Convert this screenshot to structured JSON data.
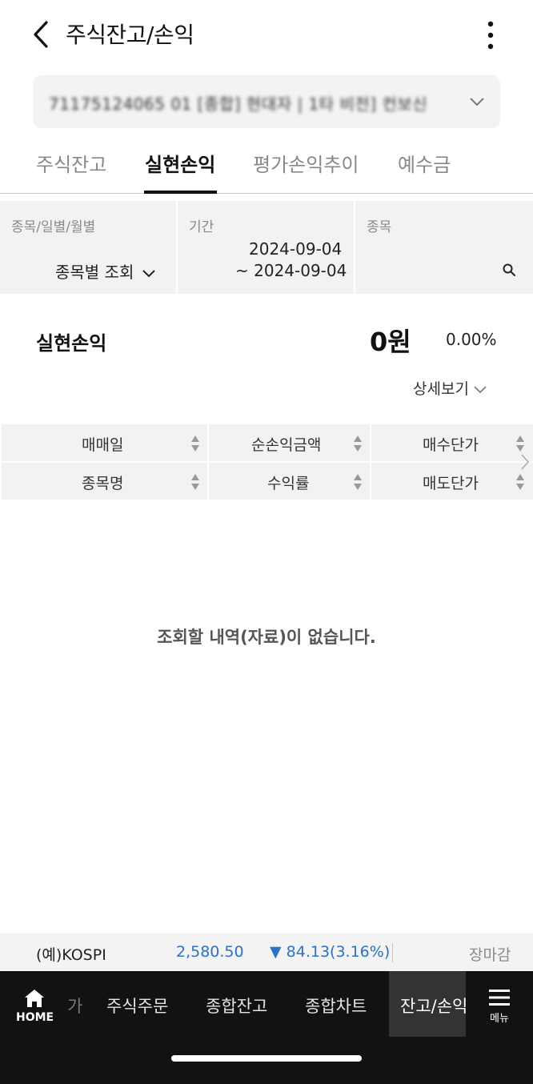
{
  "header": {
    "title": "주식잔고/손익",
    "back_icon": "chevron-left-icon",
    "more_icon": "more-vertical-icon"
  },
  "account": {
    "text": "71175124065 01 [종합] 현대자 | 1타 비전] 컨보신"
  },
  "tabs": [
    {
      "label": "주식잔고",
      "active": false
    },
    {
      "label": "실현손익",
      "active": true
    },
    {
      "label": "평가손익추이",
      "active": false
    },
    {
      "label": "예수금",
      "active": false
    }
  ],
  "filters": {
    "mode": {
      "label": "종목/일별/월별",
      "value": "종목별 조회"
    },
    "period": {
      "label": "기간",
      "from": "2024-09-04",
      "to": "~ 2024-09-04"
    },
    "stock": {
      "label": "종목",
      "value": ""
    }
  },
  "summary": {
    "label": "실현손익",
    "amount": "0원",
    "percent": "0.00%",
    "detail_label": "상세보기"
  },
  "table": {
    "headers_row1": [
      "매매일",
      "순손익금액",
      "매수단가"
    ],
    "headers_row2": [
      "종목명",
      "수익률",
      "매도단가"
    ],
    "empty_message": "조회할 내역(자료)이 없습니다."
  },
  "ticker": {
    "name": "(예)KOSPI",
    "price": "2,580.50",
    "change": "▼ 84.13(3.16%)",
    "status": "장마감",
    "down_color": "#2b71c9"
  },
  "bottom_nav": {
    "home_label": "HOME",
    "faded_item": "가",
    "items": [
      "주식주문",
      "종합잔고",
      "종합차트"
    ],
    "active_item": "잔고/손익",
    "menu_label": "메뉴"
  }
}
